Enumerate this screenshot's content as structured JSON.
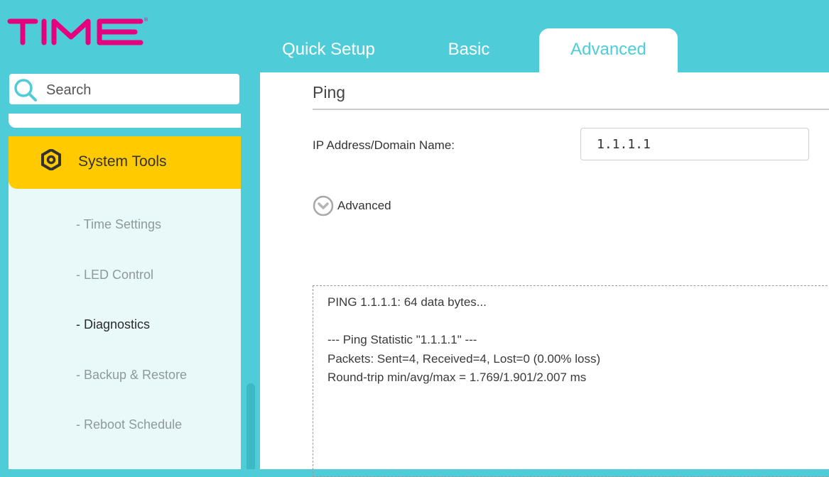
{
  "brand": {
    "logo_text": "TIME",
    "color": "#e6007e"
  },
  "colors": {
    "header_bg": "#4ecdd8",
    "accent": "#ffca00",
    "sidebar_bg": "#e9f9f9"
  },
  "tabs": [
    {
      "label": "Quick Setup",
      "active": false
    },
    {
      "label": "Basic",
      "active": false
    },
    {
      "label": "Advanced",
      "active": true
    }
  ],
  "search": {
    "placeholder": "Search",
    "icon": "search-icon"
  },
  "sidebar": {
    "section": {
      "label": "System Tools",
      "icon": "gear-icon"
    },
    "items": [
      {
        "label": "- Time Settings",
        "active": false
      },
      {
        "label": "- LED Control",
        "active": false
      },
      {
        "label": "- Diagnostics",
        "active": true
      },
      {
        "label": "- Backup & Restore",
        "active": false
      },
      {
        "label": "- Reboot Schedule",
        "active": false
      }
    ]
  },
  "main": {
    "title": "Ping",
    "ip_label": "IP Address/Domain Name:",
    "ip_value": "1.1.1.1",
    "advanced_label": "Advanced",
    "advanced_icon": "chevron-down-circle-icon",
    "output_lines": [
      "PING 1.1.1.1: 64 data bytes...",
      "",
      "--- Ping Statistic \"1.1.1.1\" ---",
      "Packets: Sent=4, Received=4, Lost=0 (0.00% loss)",
      "Round-trip min/avg/max = 1.769/1.901/2.007 ms"
    ]
  }
}
